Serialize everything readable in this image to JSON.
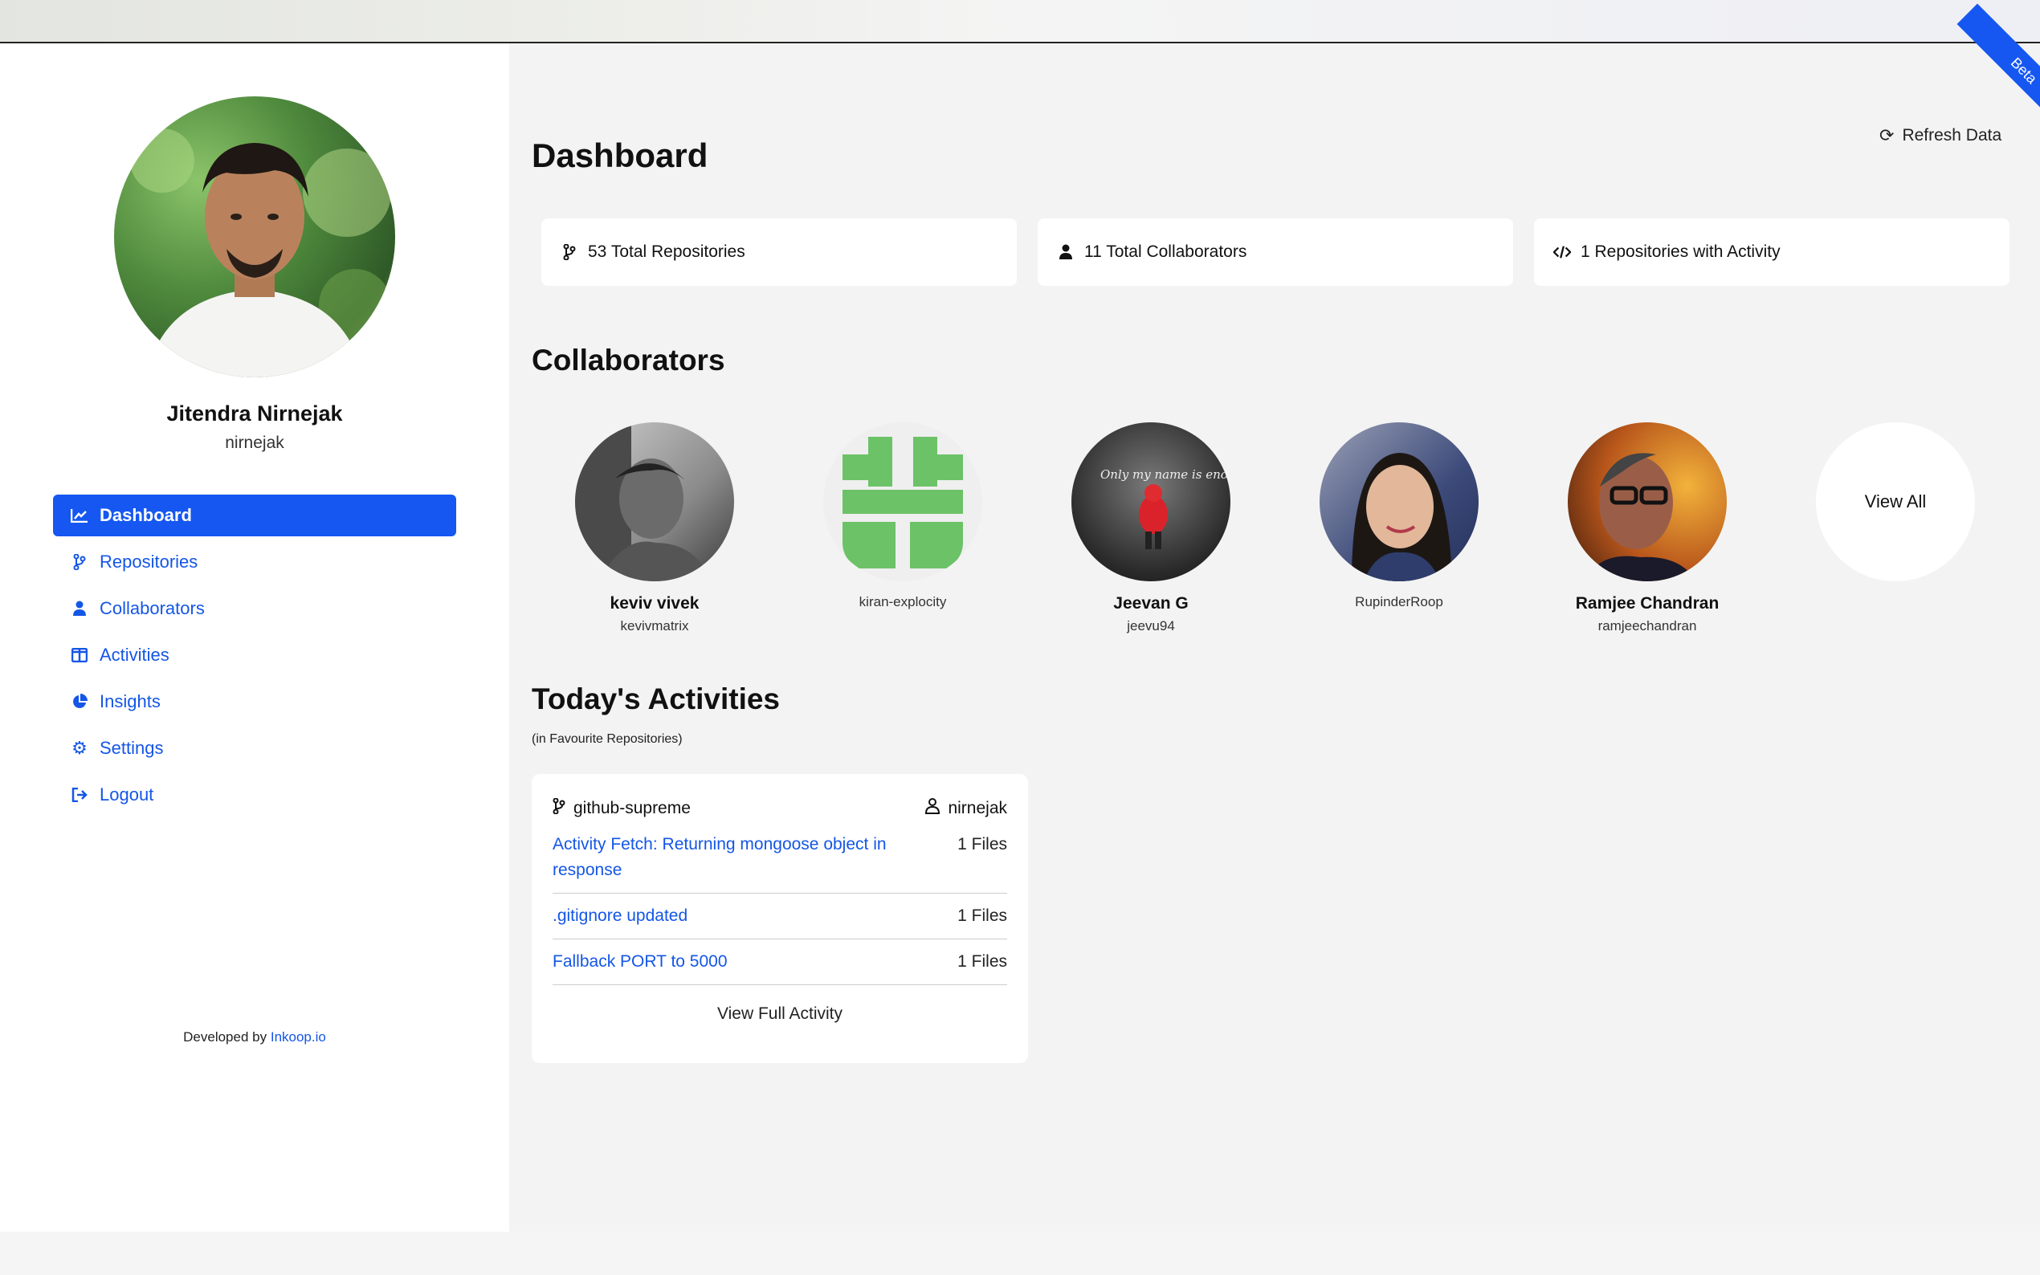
{
  "profile": {
    "name": "Jitendra Nirnejak",
    "handle": "nirnejak"
  },
  "nav": [
    {
      "label": "Dashboard",
      "icon": "chart-line-icon",
      "active": true
    },
    {
      "label": "Repositories",
      "icon": "code-branch-icon"
    },
    {
      "label": "Collaborators",
      "icon": "user-icon"
    },
    {
      "label": "Activities",
      "icon": "columns-icon"
    },
    {
      "label": "Insights",
      "icon": "pie-chart-icon"
    },
    {
      "label": "Settings",
      "icon": "gear-icon"
    },
    {
      "label": "Logout",
      "icon": "sign-out-icon"
    }
  ],
  "footer": {
    "prefix": "Developed by",
    "link": "Inkoop.io"
  },
  "header": {
    "title": "Dashboard",
    "refresh_label": "Refresh Data",
    "beta_label": "Beta"
  },
  "stats": [
    {
      "label": "53 Total Repositories",
      "icon": "code-branch-icon"
    },
    {
      "label": "11 Total Collaborators",
      "icon": "user-icon"
    },
    {
      "label": "1 Repositories with Activity",
      "icon": "code-icon"
    }
  ],
  "collaborators_section": {
    "title": "Collaborators",
    "items": [
      {
        "name": "keviv vivek",
        "handle": "kevivmatrix"
      },
      {
        "name": "",
        "handle": "kiran-explocity"
      },
      {
        "name": "Jeevan G",
        "handle": "jeevu94",
        "photo_text": "Only my name is enough..."
      },
      {
        "name": "",
        "handle": "RupinderRoop"
      },
      {
        "name": "Ramjee Chandran",
        "handle": "ramjeechandran"
      }
    ],
    "view_all": "View All"
  },
  "activities": {
    "title": "Today's Activities",
    "subtitle": "(in Favourite Repositories)",
    "repo": "github-supreme",
    "owner": "nirnejak",
    "items": [
      {
        "message": "Activity Fetch: Returning mongoose object in response",
        "files": "1 Files"
      },
      {
        "message": ".gitignore updated",
        "files": "1 Files"
      },
      {
        "message": "Fallback PORT to 5000",
        "files": "1 Files"
      }
    ],
    "view_full": "View Full Activity"
  },
  "colors": {
    "accent": "#1557f0",
    "link": "#1456e6",
    "background": "#f3f3f3"
  }
}
